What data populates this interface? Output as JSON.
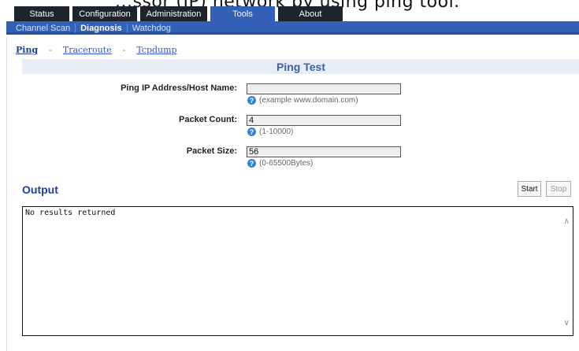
{
  "caption": "...ssor (IP) network by using ping tool.",
  "main_nav": {
    "tabs": [
      {
        "label": "Status",
        "active": false
      },
      {
        "label": "Configuration",
        "active": false
      },
      {
        "label": "Administration",
        "active": false
      },
      {
        "label": "Tools",
        "active": true
      },
      {
        "label": "About",
        "active": false
      }
    ]
  },
  "sub_nav": {
    "items": [
      {
        "label": "Channel Scan",
        "active": false
      },
      {
        "label": "Diagnosis",
        "active": true
      },
      {
        "label": "Watchdog",
        "active": false
      }
    ]
  },
  "breadcrumb": {
    "items": [
      {
        "label": "Ping",
        "active": true
      },
      {
        "label": "Traceroute",
        "active": false
      },
      {
        "label": "Tcpdump",
        "active": false
      }
    ],
    "separator": "-"
  },
  "ping_test": {
    "title": "Ping Test",
    "fields": {
      "address": {
        "label": "Ping IP Address/Host Name:",
        "value": "",
        "hint": "(example www.domain.com)"
      },
      "count": {
        "label": "Packet Count:",
        "value": "4",
        "hint": "(1-10000)"
      },
      "size": {
        "label": "Packet Size:",
        "value": "56",
        "hint": "(0-65500Bytes)"
      }
    }
  },
  "output": {
    "title": "Output",
    "start_label": "Start",
    "stop_label": "Stop",
    "text": "No results returned"
  },
  "colors": {
    "nav_dark": "#1f232b",
    "accent_blue": "#3461b8",
    "title_blue": "#3d5fb5"
  },
  "icons": {
    "help": "question-circle-icon",
    "scroll_up": "chevron-up-icon",
    "scroll_down": "chevron-down-icon"
  }
}
